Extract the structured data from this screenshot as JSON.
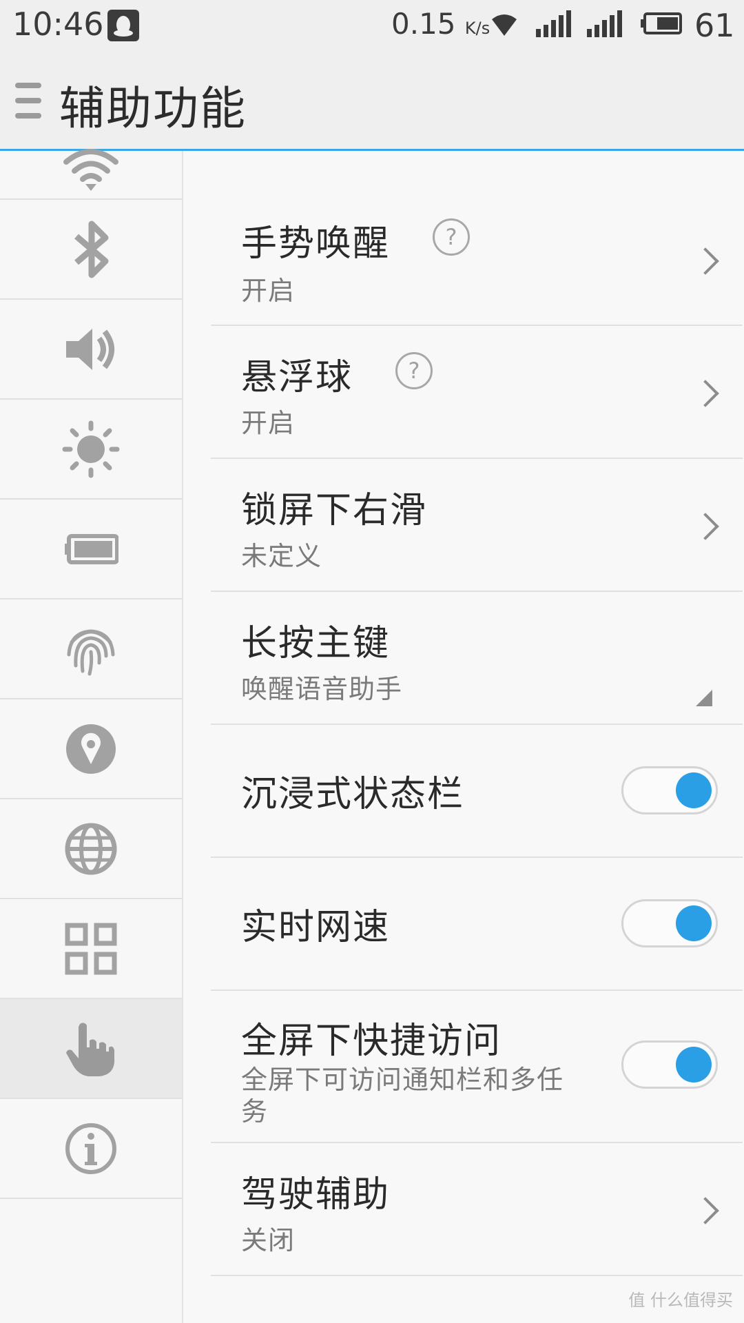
{
  "status_bar": {
    "time": "10:46",
    "net_speed": "0.15",
    "net_speed_unit": "K/s",
    "battery_level": "61"
  },
  "header": {
    "title": "辅助功能"
  },
  "sidebar": {
    "items": [
      {
        "icon": "wifi-icon"
      },
      {
        "icon": "bluetooth-icon"
      },
      {
        "icon": "speaker-icon"
      },
      {
        "icon": "brightness-icon"
      },
      {
        "icon": "battery-icon"
      },
      {
        "icon": "fingerprint-icon"
      },
      {
        "icon": "location-icon"
      },
      {
        "icon": "globe-icon"
      },
      {
        "icon": "apps-grid-icon"
      },
      {
        "icon": "hand-pointer-icon",
        "active": true
      },
      {
        "icon": "info-icon"
      }
    ]
  },
  "settings": [
    {
      "title": "手势唤醒",
      "subtitle": "开启",
      "control": "chevron",
      "help": true
    },
    {
      "title": "悬浮球",
      "subtitle": "开启",
      "control": "chevron",
      "help": true
    },
    {
      "title": "锁屏下右滑",
      "subtitle": "未定义",
      "control": "chevron"
    },
    {
      "title": "长按主键",
      "subtitle": "唤醒语音助手",
      "control": "dropdown"
    },
    {
      "title": "沉浸式状态栏",
      "control": "toggle",
      "on": true
    },
    {
      "title": "实时网速",
      "control": "toggle",
      "on": true
    },
    {
      "title": "全屏下快捷访问",
      "subtitle": "全屏下可访问通知栏和多任务",
      "control": "toggle",
      "on": true
    },
    {
      "title": "驾驶辅助",
      "subtitle": "关闭",
      "control": "chevron"
    }
  ],
  "colors": {
    "accent": "#2a9fe6",
    "header_rule": "#3aa6e6"
  },
  "watermark": "值 什么值得买"
}
